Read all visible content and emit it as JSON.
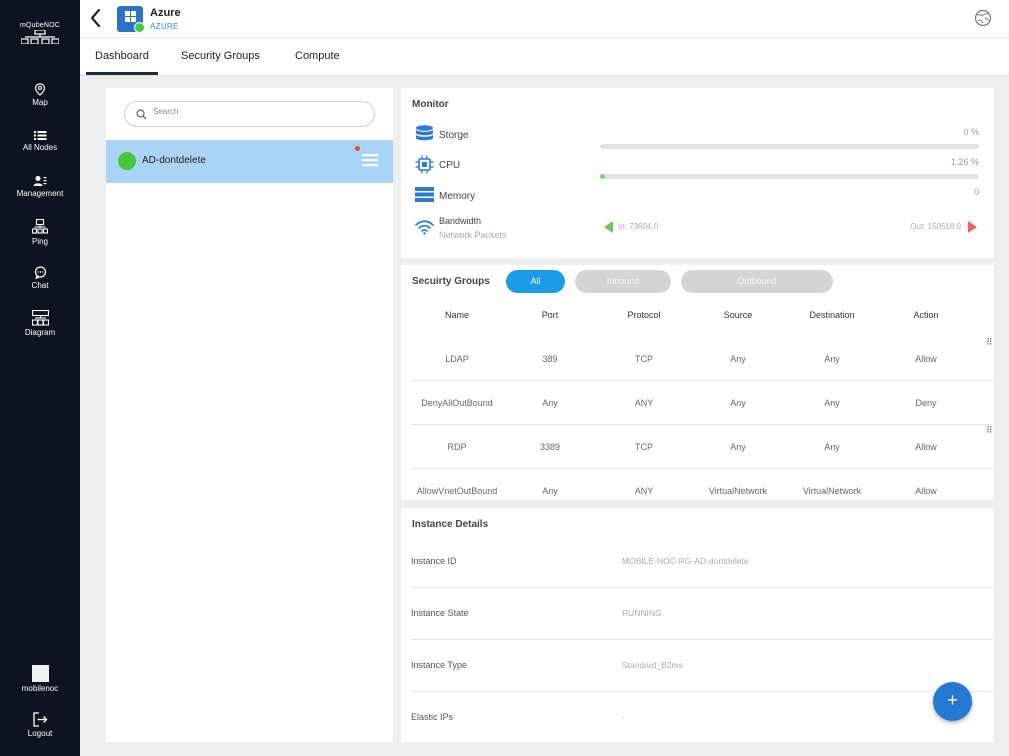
{
  "sidebar": {
    "logo_text": "mQubeNOC",
    "items": [
      {
        "label": "Map",
        "icon": "map-pin-icon"
      },
      {
        "label": "All Nodes",
        "icon": "list-icon"
      },
      {
        "label": "Management",
        "icon": "user-management-icon"
      },
      {
        "label": "Ping",
        "icon": "ping-network-icon"
      },
      {
        "label": "Chat",
        "icon": "chat-icon"
      },
      {
        "label": "Diagram",
        "icon": "diagram-icon"
      }
    ],
    "user": {
      "label": "mobilenoc"
    },
    "logout": {
      "label": "Logout",
      "icon": "logout-icon"
    }
  },
  "header": {
    "title": "Azure",
    "subtitle": "AZURE",
    "back_icon": "chevron-left-icon",
    "globe_icon": "globe-icon"
  },
  "tabs": [
    {
      "label": "Dashboard",
      "active": true
    },
    {
      "label": "Security Groups",
      "active": false
    },
    {
      "label": "Compute",
      "active": false
    }
  ],
  "node_list": {
    "search_placeholder": "Search",
    "items": [
      {
        "label": "AD-dontdelete",
        "status_color": "#45c83b",
        "selected": true
      }
    ]
  },
  "monitor": {
    "title": "Monitor",
    "storage": {
      "label": "Storge",
      "value": "0 %",
      "fraction": 0.0
    },
    "cpu": {
      "label": "CPU",
      "value": "1.26 %",
      "fraction": 0.0126
    },
    "memory": {
      "label": "Memory",
      "value": "0"
    },
    "bandwidth": {
      "label": "Bandwidth",
      "sublabel": "Network Packets",
      "in": "In: 73604.0",
      "out": "Out: 150516.0"
    }
  },
  "security_groups": {
    "title": "Secuirty Groups",
    "filters": [
      {
        "label": "All",
        "active": true
      },
      {
        "label": "Inbound",
        "active": false
      },
      {
        "label": "Outbound",
        "active": false
      }
    ],
    "columns": [
      "Name",
      "Port",
      "Protocol",
      "Source",
      "Destination",
      "Action"
    ],
    "rows": [
      {
        "name": "LDAP",
        "port": "389",
        "protocol": "TCP",
        "source": "Any",
        "destination": "Any",
        "action": "Allow",
        "handle": true
      },
      {
        "name": "DenyAllOutBound",
        "port": "Any",
        "protocol": "ANY",
        "source": "Any",
        "destination": "Any",
        "action": "Deny",
        "handle": false
      },
      {
        "name": "RDP",
        "port": "3389",
        "protocol": "TCP",
        "source": "Any",
        "destination": "Any",
        "action": "Allow",
        "handle": true
      },
      {
        "name": "AllowVnetOutBound",
        "port": "Any",
        "protocol": "ANY",
        "source": "VirtualNetwork",
        "destination": "VirtualNetwork",
        "action": "Allow",
        "handle": false
      }
    ]
  },
  "instance_details": {
    "title": "Instance Details",
    "rows": [
      {
        "label": "Instance ID",
        "value": "MOBILE-NOC-RG-AD-dontdelete"
      },
      {
        "label": "Instance State",
        "value": "RUNNING"
      },
      {
        "label": "Instance Type",
        "value": "Standard_B2ms"
      },
      {
        "label": "Elastic IPs",
        "value": "-"
      }
    ]
  },
  "fab": {
    "label": "+"
  },
  "colors": {
    "sidebar_bg": "#0d1321",
    "accent": "#1b9bea",
    "selected_row": "#a9d4f5",
    "online": "#45c83b"
  }
}
